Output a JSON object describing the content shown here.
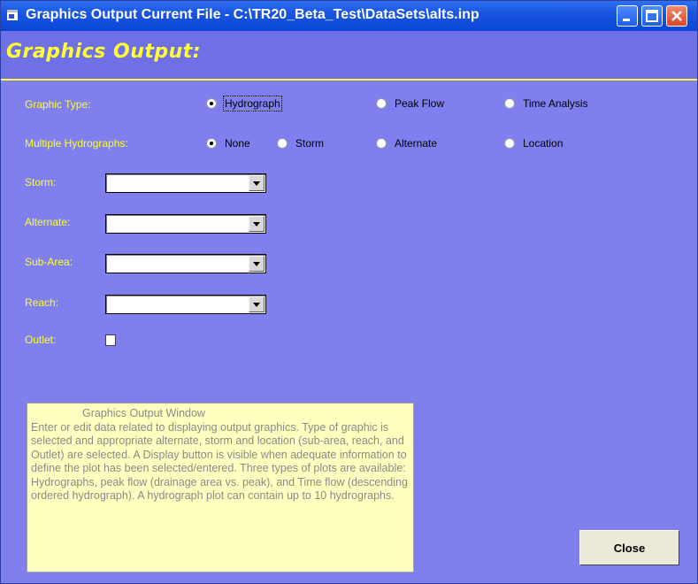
{
  "window": {
    "title": "Graphics Output   Current File - C:\\TR20_Beta_Test\\DataSets\\alts.inp",
    "title_bar_color": "#0a46d6",
    "background_color": "#7f7fee"
  },
  "header": {
    "title": "Graphics Output:",
    "color": "#ffff33"
  },
  "graphic_type": {
    "label": "Graphic Type:",
    "options": [
      "Hydrograph",
      "Peak Flow",
      "Time Analysis"
    ],
    "selected": "Hydrograph"
  },
  "multiple_hydrographs": {
    "label": "Multiple Hydrographs:",
    "options": [
      "None",
      "Storm",
      "Alternate",
      "Location"
    ],
    "selected": "None"
  },
  "fields": {
    "storm": {
      "label": "Storm:",
      "value": ""
    },
    "alternate": {
      "label": "Alternate:",
      "value": ""
    },
    "subarea": {
      "label": "Sub-Area:",
      "value": ""
    },
    "reach": {
      "label": "Reach:",
      "value": ""
    },
    "outlet": {
      "label": "Outlet:",
      "checked": false
    }
  },
  "help": {
    "title": "Graphics Output Window",
    "body": "Enter or edit data related to displaying output graphics.  Type of graphic is selected and appropriate alternate, storm and location (sub-area, reach, and Outlet) are selected.  A Display button is visible when adequate information to define the plot has been selected/entered. Three types of plots are available: Hydrographs, peak flow (drainage area vs. peak), and Time flow (descending ordered hydrograph).  A hydrograph plot can contain up to 10 hydrographs."
  },
  "buttons": {
    "close_label": "Close"
  }
}
